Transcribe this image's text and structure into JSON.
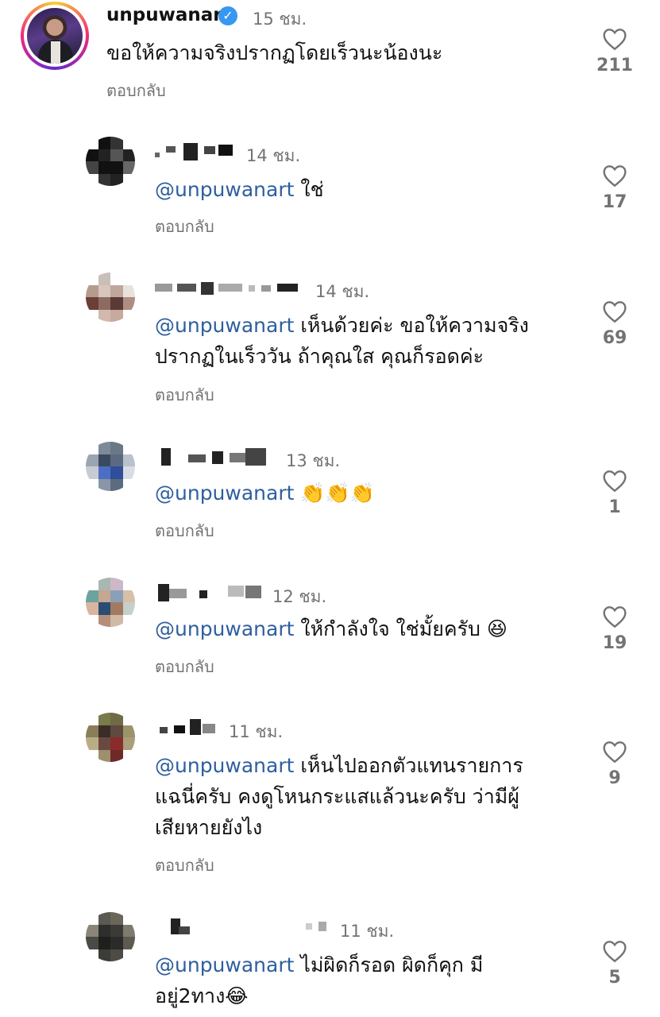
{
  "main_comment": {
    "username": "unpuwanart",
    "time": "15 ชม.",
    "text": "ขอให้ความจริงปรากฏโดยเร็วนะน้องนะ",
    "reply_label": "ตอบกลับ",
    "likes": "211"
  },
  "replies": [
    {
      "time": "14 ชม.",
      "mention": "@unpuwanart",
      "text": " ใช่",
      "reply_label": "ตอบกลับ",
      "likes": "17"
    },
    {
      "time": "14 ชม.",
      "mention": "@unpuwanart",
      "text": " เห็นด้วยค่ะ ขอให้ความจริง",
      "text2": "ปรากฏในเร็ววัน ถ้าคุณใส คุณก็รอดค่ะ",
      "reply_label": "ตอบกลับ",
      "likes": "69"
    },
    {
      "time": "13 ชม.",
      "mention": "@unpuwanart",
      "text": " 👏👏👏",
      "reply_label": "ตอบกลับ",
      "likes": "1"
    },
    {
      "time": "12 ชม.",
      "mention": "@unpuwanart",
      "text": " ให้กำลังใจ ใช่มั้ยครับ 😆",
      "reply_label": "ตอบกลับ",
      "likes": "19"
    },
    {
      "time": "11 ชม.",
      "mention": "@unpuwanart",
      "text": " เห็นไปออกตัวแทนรายการ",
      "text2": "แฉนี่ครับ คงดูโหนกระแสแล้วนะครับ ว่ามีผู้",
      "text3": "เสียหายยังไง",
      "reply_label": "ตอบกลับ",
      "likes": "9"
    },
    {
      "time": "11 ชม.",
      "mention": "@unpuwanart",
      "text": " ไม่ผิดก็รอด ผิดก็คุก มี",
      "text2": "อยู่2ทาง😂",
      "likes": "5"
    }
  ]
}
